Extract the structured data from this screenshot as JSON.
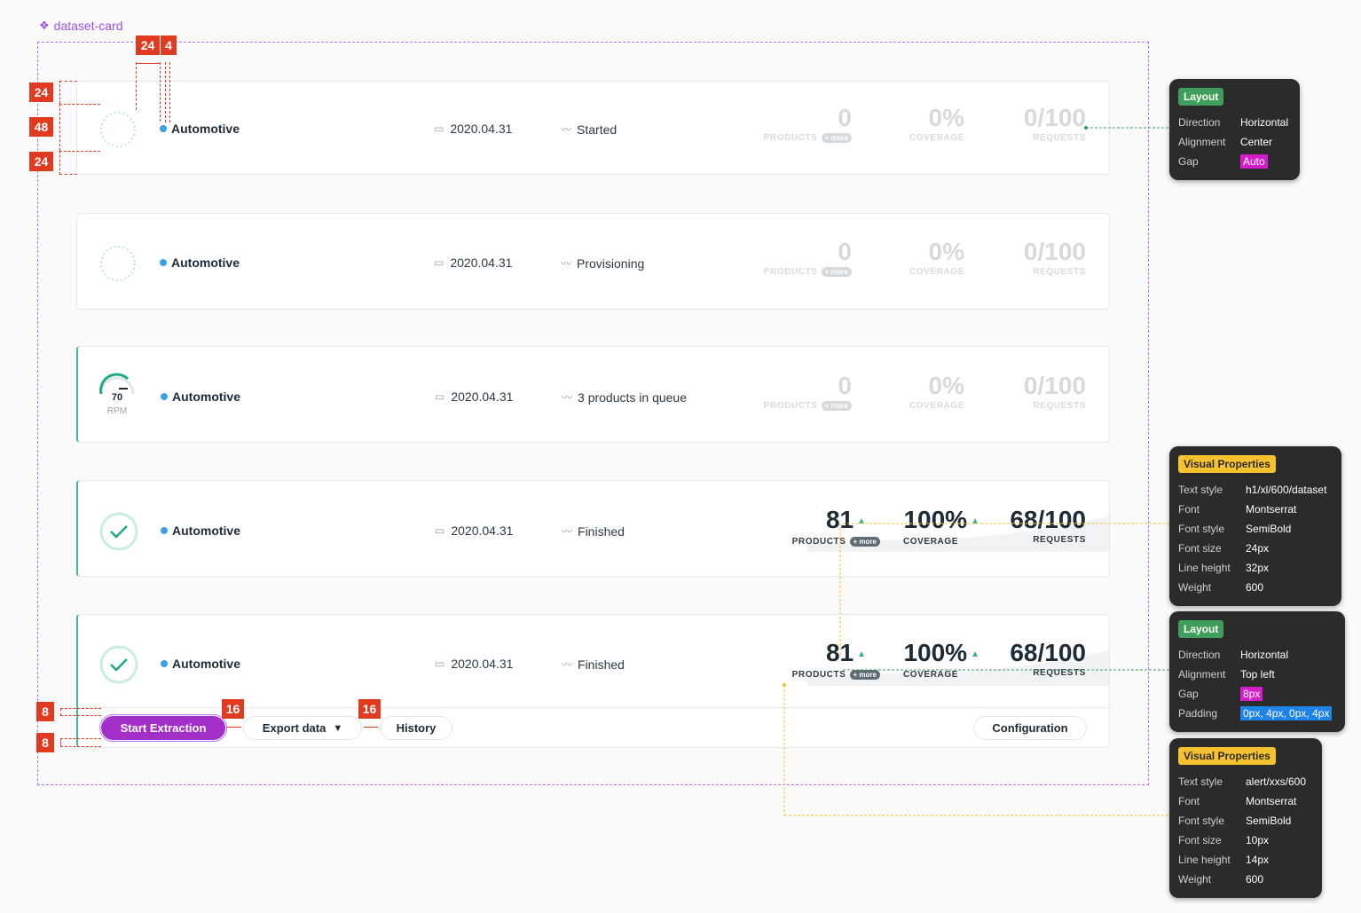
{
  "component_label": "dataset-card",
  "colors": {
    "accent": "#a42ec8",
    "success": "#2fb394",
    "dot": "#3aa0e3",
    "muted": "#d7dadd"
  },
  "cards": [
    {
      "name": "Automotive",
      "date": "2020.04.31",
      "status": "Started",
      "icon": "spinner-icon",
      "products": "0",
      "coverage": "0%",
      "requests": "0/100",
      "products_label": "PRODUCTS",
      "more": "+ more",
      "coverage_label": "COVERAGE",
      "requests_label": "REQUESTS"
    },
    {
      "name": "Automotive",
      "date": "2020.04.31",
      "status": "Provisioning",
      "icon": "spinner-icon",
      "products": "0",
      "coverage": "0%",
      "requests": "0/100",
      "products_label": "PRODUCTS",
      "more": "+ more",
      "coverage_label": "COVERAGE",
      "requests_label": "REQUESTS"
    },
    {
      "name": "Automotive",
      "date": "2020.04.31",
      "status": "3 products in queue",
      "icon": "gauge-icon",
      "gauge_value": "70",
      "gauge_unit": "RPM",
      "products": "0",
      "coverage": "0%",
      "requests": "0/100",
      "products_label": "PRODUCTS",
      "more": "+ more",
      "coverage_label": "COVERAGE",
      "requests_label": "REQUESTS"
    },
    {
      "name": "Automotive",
      "date": "2020.04.31",
      "status": "Finished",
      "icon": "check-icon",
      "products": "81",
      "coverage": "100%",
      "requests": "68/100",
      "products_label": "PRODUCTS",
      "more": "+ more",
      "coverage_label": "COVERAGE",
      "requests_label": "REQUESTS"
    },
    {
      "name": "Automotive",
      "date": "2020.04.31",
      "status": "Finished",
      "icon": "check-icon",
      "products": "81",
      "coverage": "100%",
      "requests": "68/100",
      "products_label": "PRODUCTS",
      "more": "+ more",
      "coverage_label": "COVERAGE",
      "requests_label": "REQUESTS"
    }
  ],
  "toolbar": {
    "start": "Start Extraction",
    "export": "Export data",
    "history": "History",
    "configuration": "Configuration"
  },
  "measurements": {
    "top_pad": "24",
    "icon": "48",
    "bottom_pad": "24",
    "gap_icon": "24",
    "gap_dot": "4",
    "btn_pad_top": "8",
    "btn_pad_bottom": "8",
    "gap_btn1": "16",
    "gap_btn2": "16"
  },
  "panels": {
    "layout1": {
      "title": "Layout",
      "rows": [
        [
          "Direction",
          "Horizontal"
        ],
        [
          "Alignment",
          "Center"
        ],
        [
          "Gap",
          "Auto"
        ]
      ]
    },
    "visual1": {
      "title": "Visual Properties",
      "rows": [
        [
          "Text style",
          "h1/xl/600/dataset"
        ],
        [
          "Font",
          "Montserrat"
        ],
        [
          "Font style",
          "SemiBold"
        ],
        [
          "Font size",
          "24px"
        ],
        [
          "Line height",
          "32px"
        ],
        [
          "Weight",
          "600"
        ]
      ]
    },
    "layout2": {
      "title": "Layout",
      "rows": [
        [
          "Direction",
          "Horizontal"
        ],
        [
          "Alignment",
          "Top left"
        ],
        [
          "Gap",
          "8px"
        ],
        [
          "Padding",
          "0px, 4px, 0px, 4px"
        ]
      ]
    },
    "visual2": {
      "title": "Visual Properties",
      "rows": [
        [
          "Text style",
          "alert/xxs/600"
        ],
        [
          "Font",
          "Montserrat"
        ],
        [
          "Font style",
          "SemiBold"
        ],
        [
          "Font size",
          "10px"
        ],
        [
          "Line height",
          "14px"
        ],
        [
          "Weight",
          "600"
        ]
      ]
    }
  }
}
